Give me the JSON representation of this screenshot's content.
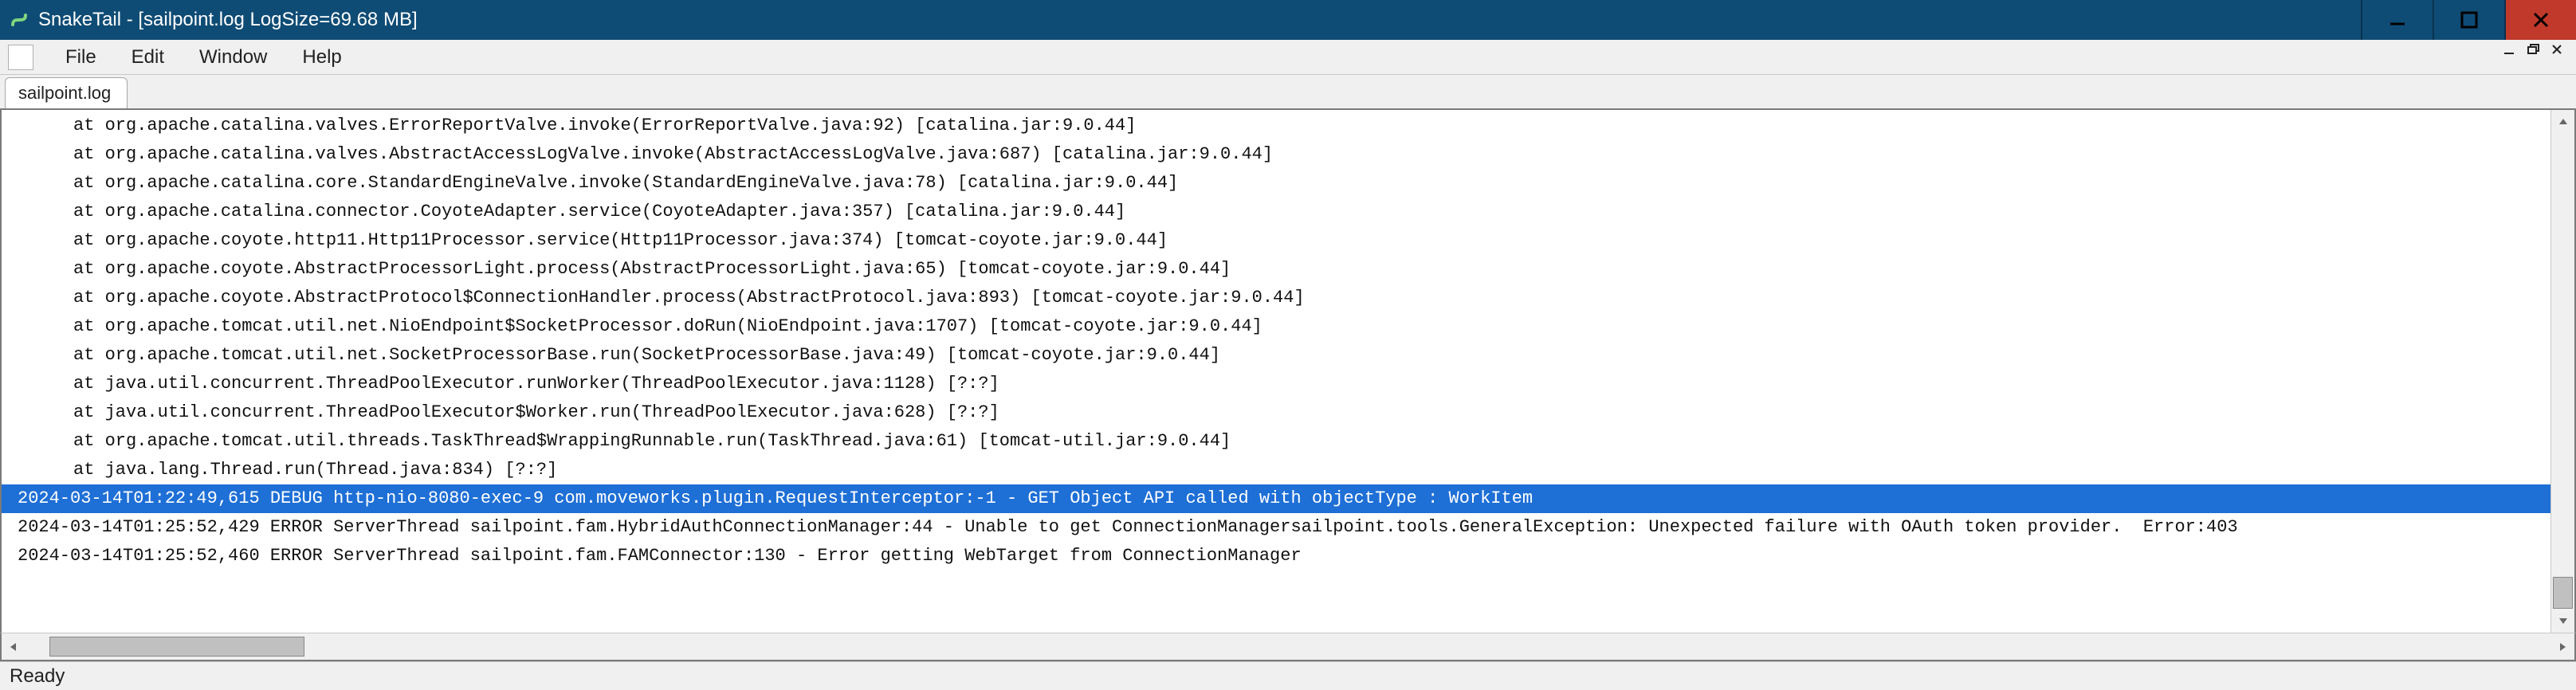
{
  "window": {
    "title": "SnakeTail - [sailpoint.log LogSize=69.68 MB]"
  },
  "menu": {
    "file": "File",
    "edit": "Edit",
    "window": "Window",
    "help": "Help"
  },
  "tabs": [
    {
      "label": "sailpoint.log"
    }
  ],
  "log": {
    "lines": [
      {
        "indent": true,
        "selected": false,
        "text": "at org.apache.catalina.valves.ErrorReportValve.invoke(ErrorReportValve.java:92) [catalina.jar:9.0.44]"
      },
      {
        "indent": true,
        "selected": false,
        "text": "at org.apache.catalina.valves.AbstractAccessLogValve.invoke(AbstractAccessLogValve.java:687) [catalina.jar:9.0.44]"
      },
      {
        "indent": true,
        "selected": false,
        "text": "at org.apache.catalina.core.StandardEngineValve.invoke(StandardEngineValve.java:78) [catalina.jar:9.0.44]"
      },
      {
        "indent": true,
        "selected": false,
        "text": "at org.apache.catalina.connector.CoyoteAdapter.service(CoyoteAdapter.java:357) [catalina.jar:9.0.44]"
      },
      {
        "indent": true,
        "selected": false,
        "text": "at org.apache.coyote.http11.Http11Processor.service(Http11Processor.java:374) [tomcat-coyote.jar:9.0.44]"
      },
      {
        "indent": true,
        "selected": false,
        "text": "at org.apache.coyote.AbstractProcessorLight.process(AbstractProcessorLight.java:65) [tomcat-coyote.jar:9.0.44]"
      },
      {
        "indent": true,
        "selected": false,
        "text": "at org.apache.coyote.AbstractProtocol$ConnectionHandler.process(AbstractProtocol.java:893) [tomcat-coyote.jar:9.0.44]"
      },
      {
        "indent": true,
        "selected": false,
        "text": "at org.apache.tomcat.util.net.NioEndpoint$SocketProcessor.doRun(NioEndpoint.java:1707) [tomcat-coyote.jar:9.0.44]"
      },
      {
        "indent": true,
        "selected": false,
        "text": "at org.apache.tomcat.util.net.SocketProcessorBase.run(SocketProcessorBase.java:49) [tomcat-coyote.jar:9.0.44]"
      },
      {
        "indent": true,
        "selected": false,
        "text": "at java.util.concurrent.ThreadPoolExecutor.runWorker(ThreadPoolExecutor.java:1128) [?:?]"
      },
      {
        "indent": true,
        "selected": false,
        "text": "at java.util.concurrent.ThreadPoolExecutor$Worker.run(ThreadPoolExecutor.java:628) [?:?]"
      },
      {
        "indent": true,
        "selected": false,
        "text": "at org.apache.tomcat.util.threads.TaskThread$WrappingRunnable.run(TaskThread.java:61) [tomcat-util.jar:9.0.44]"
      },
      {
        "indent": true,
        "selected": false,
        "text": "at java.lang.Thread.run(Thread.java:834) [?:?]"
      },
      {
        "indent": false,
        "selected": true,
        "text": "2024-03-14T01:22:49,615 DEBUG http-nio-8080-exec-9 com.moveworks.plugin.RequestInterceptor:-1 - GET Object API called with objectType : WorkItem"
      },
      {
        "indent": false,
        "selected": false,
        "text": "2024-03-14T01:25:52,429 ERROR ServerThread sailpoint.fam.HybridAuthConnectionManager:44 - Unable to get ConnectionManagersailpoint.tools.GeneralException: Unexpected failure with OAuth token provider.  Error:403"
      },
      {
        "indent": false,
        "selected": false,
        "text": "2024-03-14T01:25:52,460 ERROR ServerThread sailpoint.fam.FAMConnector:130 - Error getting WebTarget from ConnectionManager"
      }
    ]
  },
  "status": {
    "text": "Ready"
  },
  "colors": {
    "titlebar_bg": "#0f4c75",
    "close_bg": "#c0392b",
    "selection_bg": "#1e6fd6"
  }
}
